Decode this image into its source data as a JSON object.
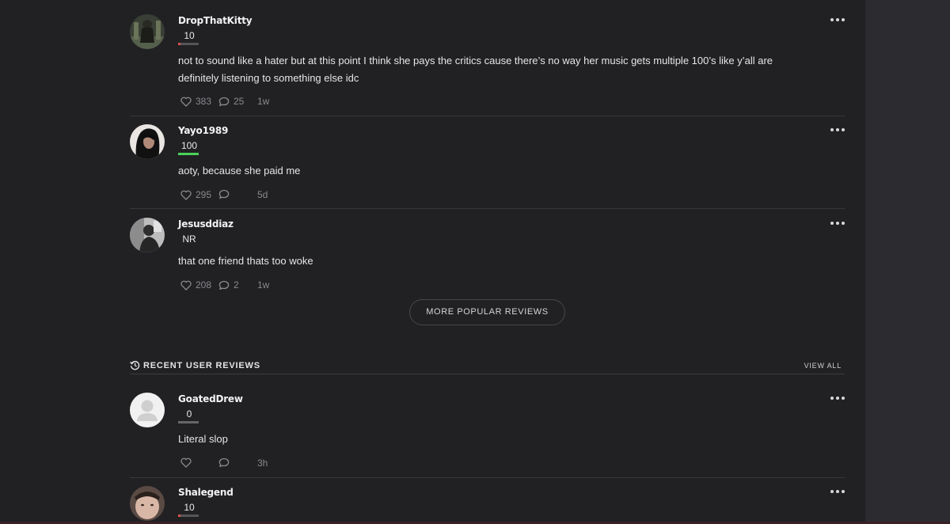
{
  "popular_reviews": [
    {
      "username": "DropThatKitty",
      "score": "10",
      "score_value": 10,
      "bar_color": "#d9534f",
      "text": "not to sound like a hater but at this point I think she pays the critics cause there’s no way her music gets multiple 100’s like y’all are definitely listening to something else idc",
      "likes": "383",
      "comments": "25",
      "time": "1w",
      "avatar": "avatar-photo-dark-figure"
    },
    {
      "username": "Yayo1989",
      "score": "100",
      "score_value": 100,
      "bar_color": "#4bd35a",
      "text": "aoty, because she paid me",
      "likes": "295",
      "comments": "",
      "time": "5d",
      "avatar": "avatar-photo-portrait"
    },
    {
      "username": "Jesusddiaz",
      "score": "NR",
      "score_value": null,
      "bar_color": "",
      "text": "that one friend thats too woke",
      "likes": "208",
      "comments": "2",
      "time": "1w",
      "avatar": "avatar-photo-grayscale"
    }
  ],
  "more_button_label": "MORE POPULAR REVIEWS",
  "recent_section": {
    "title": "RECENT USER REVIEWS",
    "view_all_label": "VIEW ALL",
    "icon": "history-icon"
  },
  "recent_reviews": [
    {
      "username": "GoatedDrew",
      "score": "0",
      "score_value": 0,
      "bar_color": "#666666",
      "text": "Literal slop",
      "likes": "",
      "comments": "",
      "time": "3h",
      "avatar": "default-avatar"
    },
    {
      "username": "Shalegend",
      "score": "10",
      "score_value": 10,
      "bar_color": "#d9534f",
      "text": "",
      "likes": "",
      "comments": "",
      "time": "",
      "avatar": "avatar-photo-face"
    }
  ],
  "colors": {
    "background": "#212124",
    "sidebar": "#2c2c30",
    "text": "#e6e6e6",
    "muted": "#8a8a8e",
    "score_red": "#d9534f",
    "score_green": "#4bd35a"
  }
}
